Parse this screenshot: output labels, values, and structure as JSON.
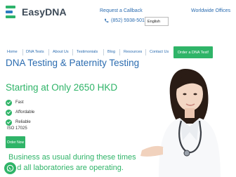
{
  "brand": {
    "name": "EasyDNA"
  },
  "header": {
    "callback": "Request a Callback",
    "phone": "(852) 5938-5018",
    "worldwide": "Worldwide Offices",
    "language": "English"
  },
  "nav": {
    "items": [
      "Home",
      "DNA Tests",
      "About Us",
      "Testimonials",
      "Blog",
      "Resources",
      "Contact Us"
    ],
    "cta": "Order a DNA Test!"
  },
  "hero": {
    "title": "DNA Testing & Paternity Testing",
    "subtitle": "Starting at Only 2650 HKD",
    "features": [
      "Fast",
      "Affordable",
      "Reliable"
    ],
    "iso": "ISO 17025",
    "order_button": "Order Now",
    "notice": "Business as usual during these times and all laboratories are operating."
  },
  "icons": {
    "phone": "phone-icon",
    "check": "check-icon",
    "whatsapp": "whatsapp-icon"
  },
  "colors": {
    "blue": "#2b6cb0",
    "green": "#2fb468"
  }
}
